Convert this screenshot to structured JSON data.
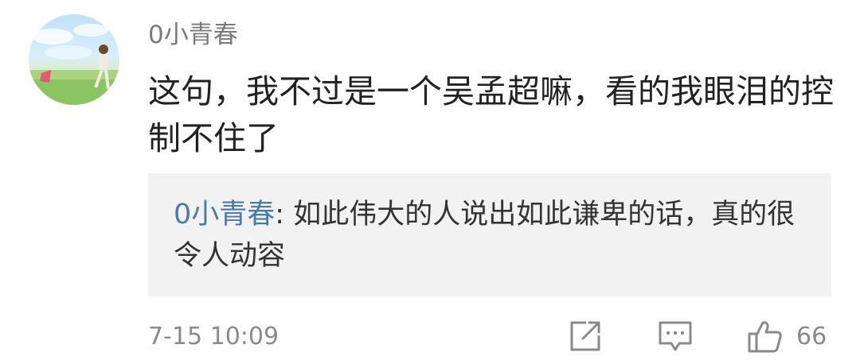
{
  "comment": {
    "author": "0小青春",
    "text": "这句，我不过是一个吴孟超嘛，看的我眼泪的控制不住了",
    "avatar_icon": "avatar-photo-icon"
  },
  "reply": {
    "author": "0小青春",
    "separator": ": ",
    "text": "如此伟大的人说出如此谦卑的话，真的很令人动容"
  },
  "footer": {
    "time": "7-15 10:09",
    "share_icon": "share-edit-icon",
    "comment_icon": "comment-bubble-icon",
    "like_icon": "thumbs-up-icon",
    "like_count": "66"
  },
  "colors": {
    "username": "#7b7b7b",
    "reply_author": "#4a7aa8",
    "reply_bg": "#f2f2f2",
    "icon_stroke": "#8a8a8a"
  }
}
